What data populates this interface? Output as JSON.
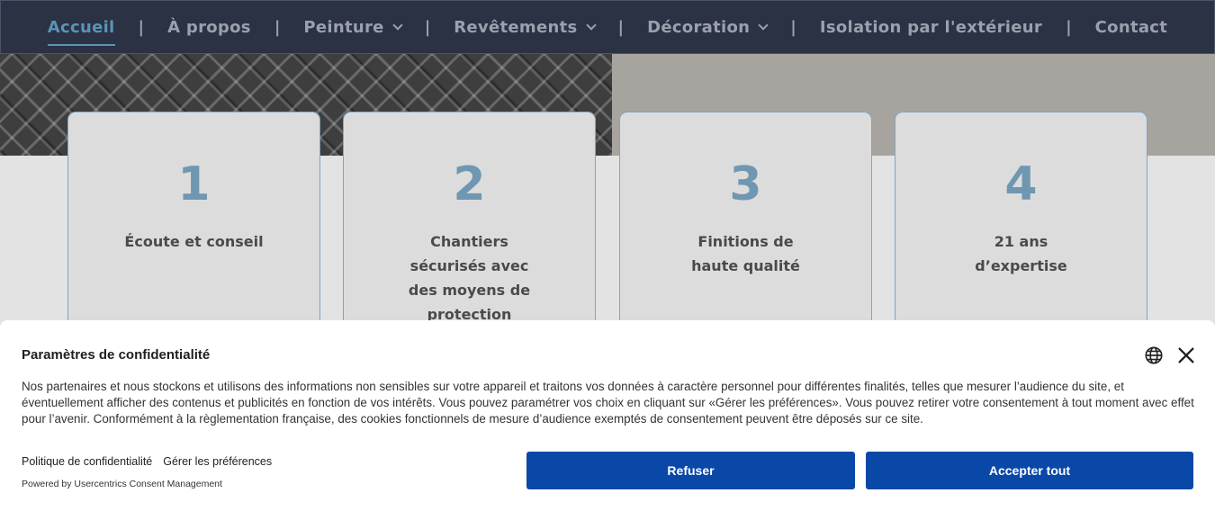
{
  "nav": {
    "items": [
      {
        "label": "Accueil",
        "active": true,
        "dropdown": false
      },
      {
        "label": "À propos",
        "active": false,
        "dropdown": false
      },
      {
        "label": "Peinture",
        "active": false,
        "dropdown": true
      },
      {
        "label": "Revêtements",
        "active": false,
        "dropdown": true
      },
      {
        "label": "Décoration",
        "active": false,
        "dropdown": true
      },
      {
        "label": "Isolation par l'extérieur",
        "active": false,
        "dropdown": false
      },
      {
        "label": "Contact",
        "active": false,
        "dropdown": false
      }
    ],
    "separator": "|"
  },
  "cards": [
    {
      "number": "1",
      "text": "Écoute et conseil"
    },
    {
      "number": "2",
      "text": "Chantiers sécurisés avec des moyens de protection"
    },
    {
      "number": "3",
      "text": "Finitions de haute qualité"
    },
    {
      "number": "4",
      "text": "21 ans d’expertise"
    }
  ],
  "consent": {
    "title": "Paramètres de confidentialité",
    "body": "Nos partenaires et nous stockons et utilisons des informations non sensibles sur votre appareil et traitons vos données à caractère personnel pour différentes finalités, telles que mesurer l’audience du site, et éventuellement afficher des contenus et publicités en fonction de vos intérêts. Vous pouvez paramétrer vos choix en cliquant sur «Gérer les préférences». Vous pouvez retirer votre consentement à tout moment avec effet pour l’avenir. Conformément à la règlementation française, des cookies fonctionnels de mesure d’audience exemptés de consentement peuvent être déposés sur ce site.",
    "privacy_link": "Politique de confidentialité",
    "manage_link": "Gérer les préférences",
    "powered_by": "Powered by Usercentrics Consent Management",
    "refuse_label": "Refuser",
    "accept_label": "Accepter tout"
  },
  "colors": {
    "nav_bg": "#2a3243",
    "accent": "#5b93b8",
    "button": "#0a48a8"
  },
  "icons": {
    "language": "globe-icon",
    "close": "close-icon",
    "dropdown": "chevron-down-icon"
  }
}
